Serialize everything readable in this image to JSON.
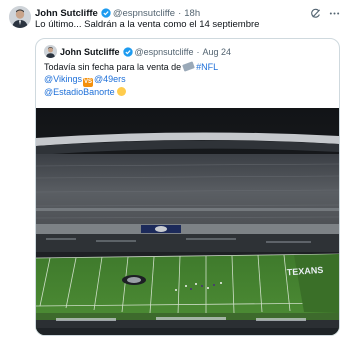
{
  "tweet": {
    "author_name": "John Sutcliffe",
    "handle": "@espnsutcliffe",
    "separator": "·",
    "time": "18h",
    "text": "Lo último... Saldrán a la venta como el 14 septiembre"
  },
  "quoted": {
    "author_name": "John Sutcliffe",
    "handle": "@espnsutcliffe",
    "separator": "·",
    "date": "Aug 24",
    "line1_text": "Todavía sin fecha para la venta de",
    "line1_hashtag": "#NFL",
    "line2_team_a": "@Vikings",
    "line2_vs": "VS",
    "line2_team_b": "@49ers",
    "line3_mention": "@EstadioBanorte",
    "field_text": "TEXANS"
  },
  "icons": {
    "verified": "verified-badge-icon",
    "grok": "grok-icon",
    "more": "more-options-icon"
  },
  "colors": {
    "verified": "#1d9bf0",
    "link": "#1d6fd8",
    "muted": "#536471",
    "border": "#cfd9de"
  }
}
